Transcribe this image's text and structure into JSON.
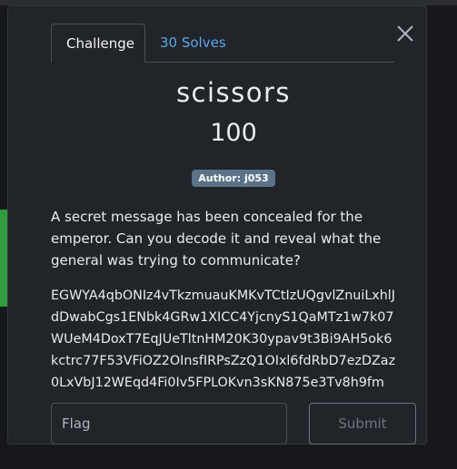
{
  "tabs": [
    {
      "label": "Challenge",
      "active": true
    },
    {
      "label": "30 Solves",
      "active": false
    }
  ],
  "challenge": {
    "name": "scissors",
    "points": "100",
    "author": "Author: j053",
    "description": "A secret message has been concealed for the emperor. Can you decode it and reveal what the general was trying to communicate?",
    "ciphertext_lines": [
      "EGWYA4qbONIz4vTkzmuauKMKvTCtIzUQgvlZnuiLxhlJ",
      "dDwabCgs1ENbk4GRw1XICC4YjcnyS1QaMTz1w7k07",
      "WUeM4DoxT7EqJUeTltnHM20K30ypav9t3Bi9AH5ok6",
      "kctrc77F53VFiOZ2OInsfIRPsZzQ1OIxl6fdRbD7ezDZaz",
      "0LxVbJ12WEqd4Fi0Iv5FPLOKvn3sKN875e3Tv8h9fm"
    ]
  },
  "form": {
    "flag_placeholder": "Flag",
    "submit_label": "Submit"
  },
  "icons": {
    "close": "close-icon"
  },
  "colors": {
    "link": "#5aa7ef",
    "badge": "#5b7389",
    "modal_bg": "#212529"
  }
}
